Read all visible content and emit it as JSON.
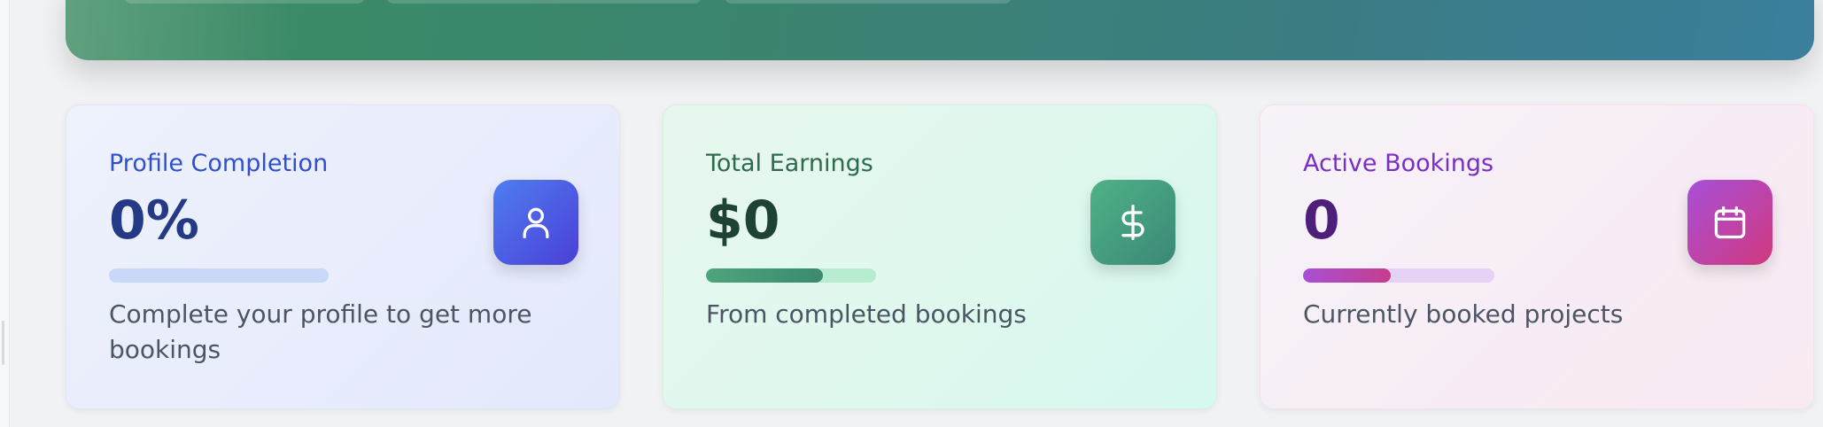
{
  "cards": [
    {
      "title": "Profile Completion",
      "value": "0%",
      "description": "Complete your profile to get more bookings",
      "icon": "user-icon",
      "progress": 0,
      "colors": {
        "title": "#2f4fcf",
        "value": "#243a86",
        "track": "#c8d8f6",
        "fill": "#4f6ae8",
        "icon_bg_start": "#4f7df0",
        "icon_bg_end": "#4b3fd7"
      }
    },
    {
      "title": "Total Earnings",
      "value": "$0",
      "description": "From completed bookings",
      "icon": "dollar-icon",
      "progress": 0.69,
      "colors": {
        "title": "#2e6a4d",
        "value": "#1e4233",
        "track": "#b7ecd0",
        "fill": "#3b8a6f",
        "icon_bg_start": "#4fb286",
        "icon_bg_end": "#3b8878"
      }
    },
    {
      "title": "Active Bookings",
      "value": "0",
      "description": "Currently booked projects",
      "icon": "calendar-icon",
      "progress": 0.46,
      "colors": {
        "title": "#7a2fc4",
        "value": "#4d1f7a",
        "track": "#e6d2f4",
        "fill": "#c63d8c",
        "icon_bg_start": "#a84fd8",
        "icon_bg_end": "#d0397d"
      }
    }
  ]
}
